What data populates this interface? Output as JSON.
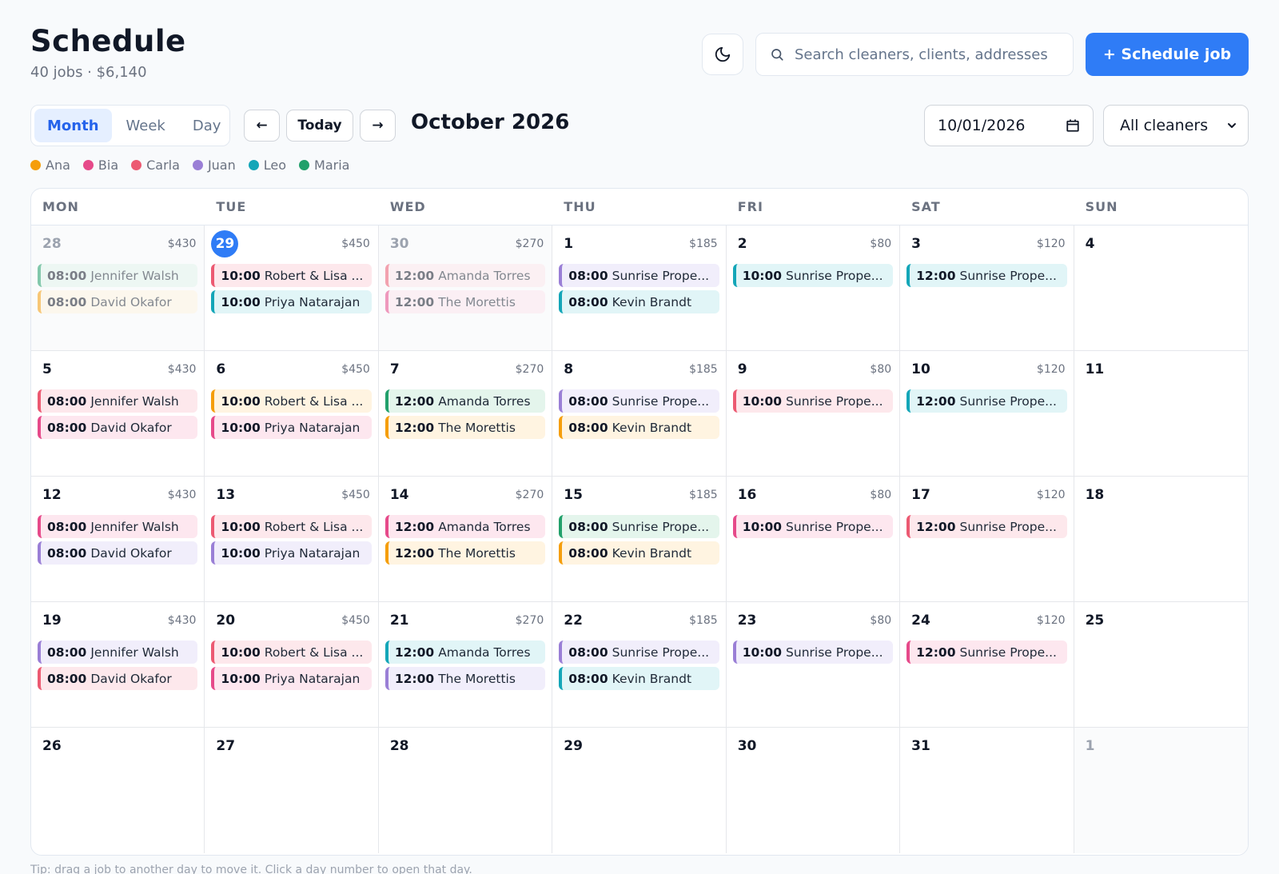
{
  "header": {
    "title": "Schedule",
    "subtitle": "40 jobs · $6,140",
    "search_placeholder": "Search cleaners, clients, addresses",
    "schedule_button": "+ Schedule job",
    "theme_icon": "moon-icon"
  },
  "toolbar": {
    "views": [
      "Month",
      "Week",
      "Day"
    ],
    "active_view": "Month",
    "prev_label": "←",
    "today_label": "Today",
    "next_label": "→",
    "month_label": "October 2026",
    "date_value": "10/01/2026",
    "cleaner_filter": "All cleaners"
  },
  "colors": {
    "accent": "#2f7cf6",
    "today_bg": "#2f7cf6"
  },
  "legend": [
    {
      "name": "Ana",
      "color": "#f59e0b",
      "bg": "#fff4e1"
    },
    {
      "name": "Bia",
      "color": "#e64a8a",
      "bg": "#fde7ef"
    },
    {
      "name": "Carla",
      "color": "#ec5a72",
      "bg": "#fde8ec"
    },
    {
      "name": "Juan",
      "color": "#9a7fd6",
      "bg": "#f1eefb"
    },
    {
      "name": "Leo",
      "color": "#14a6b8",
      "bg": "#e1f5f7"
    },
    {
      "name": "Maria",
      "color": "#22a06b",
      "bg": "#e4f5ec"
    }
  ],
  "weekdays": [
    "MON",
    "TUE",
    "WED",
    "THU",
    "FRI",
    "SAT",
    "SUN"
  ],
  "days": [
    {
      "num": "28",
      "total": "$430",
      "outside": true,
      "jobs": [
        {
          "time": "08:00",
          "client": "Jennifer Walsh",
          "cleaner": "Maria"
        },
        {
          "time": "08:00",
          "client": "David Okafor",
          "cleaner": "Ana"
        }
      ]
    },
    {
      "num": "29",
      "total": "$450",
      "today": true,
      "jobs": [
        {
          "time": "10:00",
          "client": "Robert & Lisa ...",
          "cleaner": "Carla"
        },
        {
          "time": "10:00",
          "client": "Priya Natarajan",
          "cleaner": "Leo"
        }
      ]
    },
    {
      "num": "30",
      "total": "$270",
      "outside": true,
      "jobs": [
        {
          "time": "12:00",
          "client": "Amanda Torres",
          "cleaner": "Carla"
        },
        {
          "time": "12:00",
          "client": "The Morettis",
          "cleaner": "Bia"
        }
      ]
    },
    {
      "num": "1",
      "total": "$185",
      "jobs": [
        {
          "time": "08:00",
          "client": "Sunrise Prope...",
          "cleaner": "Juan"
        },
        {
          "time": "08:00",
          "client": "Kevin Brandt",
          "cleaner": "Leo"
        }
      ]
    },
    {
      "num": "2",
      "total": "$80",
      "jobs": [
        {
          "time": "10:00",
          "client": "Sunrise Prope...",
          "cleaner": "Leo"
        }
      ]
    },
    {
      "num": "3",
      "total": "$120",
      "jobs": [
        {
          "time": "12:00",
          "client": "Sunrise Prope...",
          "cleaner": "Leo"
        }
      ]
    },
    {
      "num": "4",
      "total": "",
      "jobs": []
    },
    {
      "num": "5",
      "total": "$430",
      "jobs": [
        {
          "time": "08:00",
          "client": "Jennifer Walsh",
          "cleaner": "Carla"
        },
        {
          "time": "08:00",
          "client": "David Okafor",
          "cleaner": "Bia"
        }
      ]
    },
    {
      "num": "6",
      "total": "$450",
      "jobs": [
        {
          "time": "10:00",
          "client": "Robert & Lisa ...",
          "cleaner": "Ana"
        },
        {
          "time": "10:00",
          "client": "Priya Natarajan",
          "cleaner": "Bia"
        }
      ]
    },
    {
      "num": "7",
      "total": "$270",
      "jobs": [
        {
          "time": "12:00",
          "client": "Amanda Torres",
          "cleaner": "Maria"
        },
        {
          "time": "12:00",
          "client": "The Morettis",
          "cleaner": "Ana"
        }
      ]
    },
    {
      "num": "8",
      "total": "$185",
      "jobs": [
        {
          "time": "08:00",
          "client": "Sunrise Prope...",
          "cleaner": "Juan"
        },
        {
          "time": "08:00",
          "client": "Kevin Brandt",
          "cleaner": "Ana"
        }
      ]
    },
    {
      "num": "9",
      "total": "$80",
      "jobs": [
        {
          "time": "10:00",
          "client": "Sunrise Prope...",
          "cleaner": "Carla"
        }
      ]
    },
    {
      "num": "10",
      "total": "$120",
      "jobs": [
        {
          "time": "12:00",
          "client": "Sunrise Prope...",
          "cleaner": "Leo"
        }
      ]
    },
    {
      "num": "11",
      "total": "",
      "jobs": []
    },
    {
      "num": "12",
      "total": "$430",
      "jobs": [
        {
          "time": "08:00",
          "client": "Jennifer Walsh",
          "cleaner": "Bia"
        },
        {
          "time": "08:00",
          "client": "David Okafor",
          "cleaner": "Juan"
        }
      ]
    },
    {
      "num": "13",
      "total": "$450",
      "jobs": [
        {
          "time": "10:00",
          "client": "Robert & Lisa ...",
          "cleaner": "Carla"
        },
        {
          "time": "10:00",
          "client": "Priya Natarajan",
          "cleaner": "Juan"
        }
      ]
    },
    {
      "num": "14",
      "total": "$270",
      "jobs": [
        {
          "time": "12:00",
          "client": "Amanda Torres",
          "cleaner": "Bia"
        },
        {
          "time": "12:00",
          "client": "The Morettis",
          "cleaner": "Ana"
        }
      ]
    },
    {
      "num": "15",
      "total": "$185",
      "jobs": [
        {
          "time": "08:00",
          "client": "Sunrise Prope...",
          "cleaner": "Maria"
        },
        {
          "time": "08:00",
          "client": "Kevin Brandt",
          "cleaner": "Ana"
        }
      ]
    },
    {
      "num": "16",
      "total": "$80",
      "jobs": [
        {
          "time": "10:00",
          "client": "Sunrise Prope...",
          "cleaner": "Bia"
        }
      ]
    },
    {
      "num": "17",
      "total": "$120",
      "jobs": [
        {
          "time": "12:00",
          "client": "Sunrise Prope...",
          "cleaner": "Carla"
        }
      ]
    },
    {
      "num": "18",
      "total": "",
      "jobs": []
    },
    {
      "num": "19",
      "total": "$430",
      "jobs": [
        {
          "time": "08:00",
          "client": "Jennifer Walsh",
          "cleaner": "Juan"
        },
        {
          "time": "08:00",
          "client": "David Okafor",
          "cleaner": "Carla"
        }
      ]
    },
    {
      "num": "20",
      "total": "$450",
      "jobs": [
        {
          "time": "10:00",
          "client": "Robert & Lisa ...",
          "cleaner": "Carla"
        },
        {
          "time": "10:00",
          "client": "Priya Natarajan",
          "cleaner": "Bia"
        }
      ]
    },
    {
      "num": "21",
      "total": "$270",
      "jobs": [
        {
          "time": "12:00",
          "client": "Amanda Torres",
          "cleaner": "Leo"
        },
        {
          "time": "12:00",
          "client": "The Morettis",
          "cleaner": "Juan"
        }
      ]
    },
    {
      "num": "22",
      "total": "$185",
      "jobs": [
        {
          "time": "08:00",
          "client": "Sunrise Prope...",
          "cleaner": "Juan"
        },
        {
          "time": "08:00",
          "client": "Kevin Brandt",
          "cleaner": "Leo"
        }
      ]
    },
    {
      "num": "23",
      "total": "$80",
      "jobs": [
        {
          "time": "10:00",
          "client": "Sunrise Prope...",
          "cleaner": "Juan"
        }
      ]
    },
    {
      "num": "24",
      "total": "$120",
      "jobs": [
        {
          "time": "12:00",
          "client": "Sunrise Prope...",
          "cleaner": "Bia"
        }
      ]
    },
    {
      "num": "25",
      "total": "",
      "jobs": []
    },
    {
      "num": "26",
      "total": "",
      "jobs": []
    },
    {
      "num": "27",
      "total": "",
      "jobs": []
    },
    {
      "num": "28",
      "total": "",
      "jobs": []
    },
    {
      "num": "29",
      "total": "",
      "jobs": []
    },
    {
      "num": "30",
      "total": "",
      "jobs": []
    },
    {
      "num": "31",
      "total": "",
      "jobs": []
    },
    {
      "num": "1",
      "total": "",
      "outside": true,
      "jobs": []
    }
  ],
  "tip": "Tip: drag a job to another day to move it. Click a day number to open that day."
}
